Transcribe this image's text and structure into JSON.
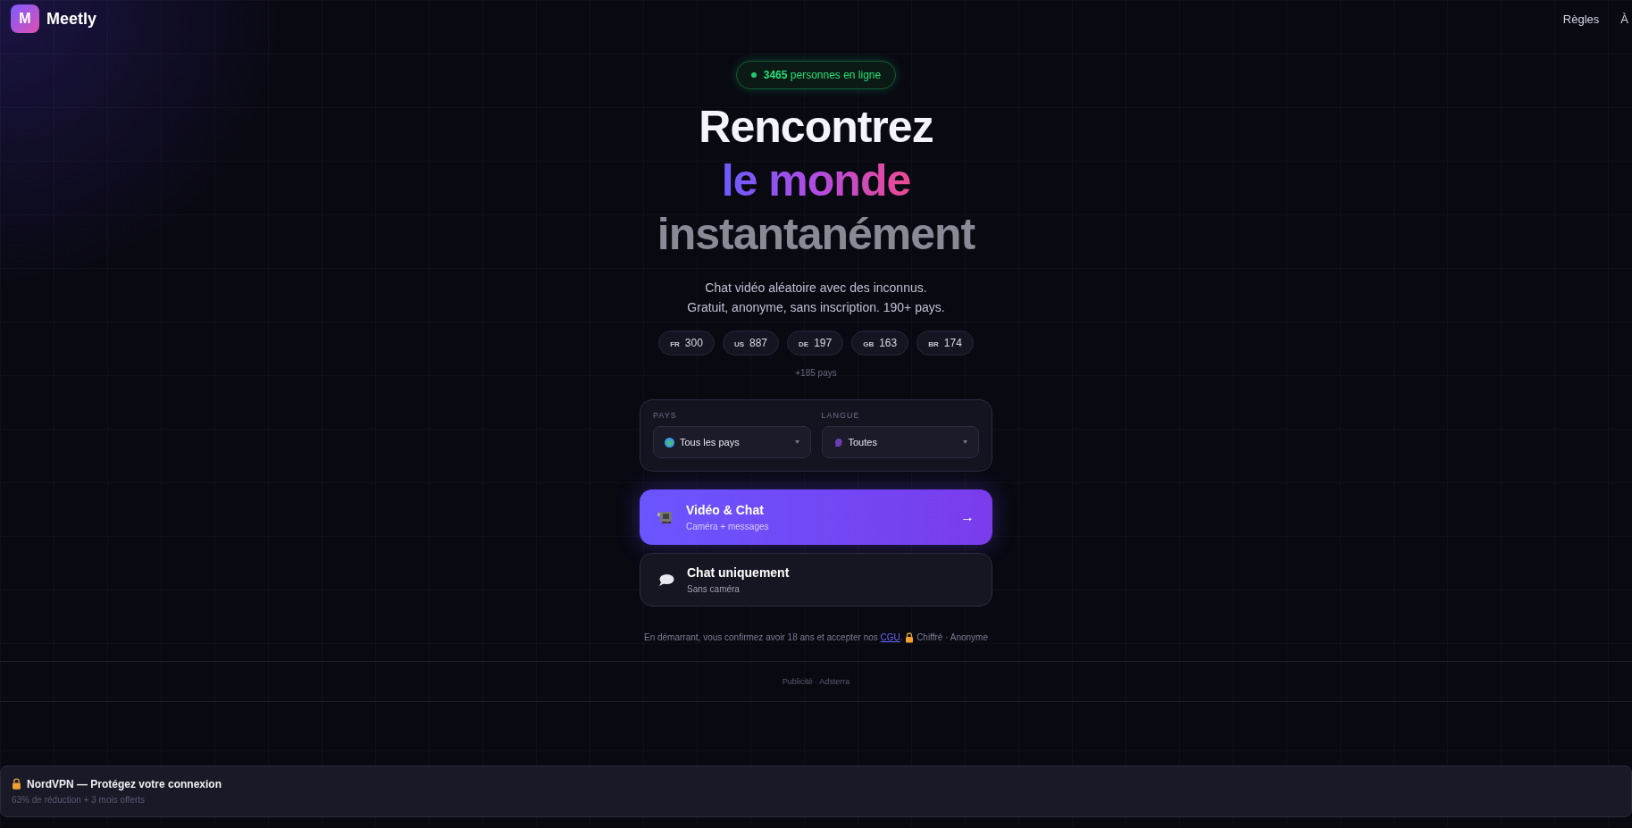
{
  "header": {
    "logo_letter": "M",
    "brand": "Meetly",
    "nav": [
      "Règles",
      "À"
    ]
  },
  "online_badge": "**3465** personnes en ligne",
  "headline": {
    "line_1": "Rencontrez",
    "line_2": "le monde",
    "line_3": "instantanément"
  },
  "subtitle": [
    "Chat vidéo aléatoire avec des inconnus.",
    "Gratuit, anonyme, sans inscription. 190+ pays."
  ],
  "countries": [
    {
      "code": "FR",
      "count": "300"
    },
    {
      "code": "US",
      "count": "887"
    },
    {
      "code": "DE",
      "count": "197"
    },
    {
      "code": "GB",
      "count": "163"
    },
    {
      "code": "BR",
      "count": "174"
    }
  ],
  "more_countries": "+185 pays",
  "filters": [
    {
      "label": "PAYS",
      "value": "Tous les pays",
      "kind": "globe"
    },
    {
      "label": "LANGUE",
      "value": "Toutes",
      "kind": "speech"
    }
  ],
  "modes": [
    {
      "title": "Vidéo & Chat",
      "subtitle": "Caméra + messages",
      "kind": "video",
      "selected": true,
      "arrow": "→"
    },
    {
      "title": "Chat uniquement",
      "subtitle": "Sans caméra",
      "kind": "chat",
      "selected": false
    }
  ],
  "disclaimer": {
    "text": "En démarrant, vous confirmez avoir 18 ans et accepter nos",
    "link": "CGU",
    "after": ".",
    "note": "Chiffré · Anonyme"
  },
  "ad_label": "Publicité · Adsterra",
  "ad_banner": {
    "title": "NordVPN — Protégez votre connexion",
    "subtitle": "63% de réduction + 3 mois offerts"
  }
}
